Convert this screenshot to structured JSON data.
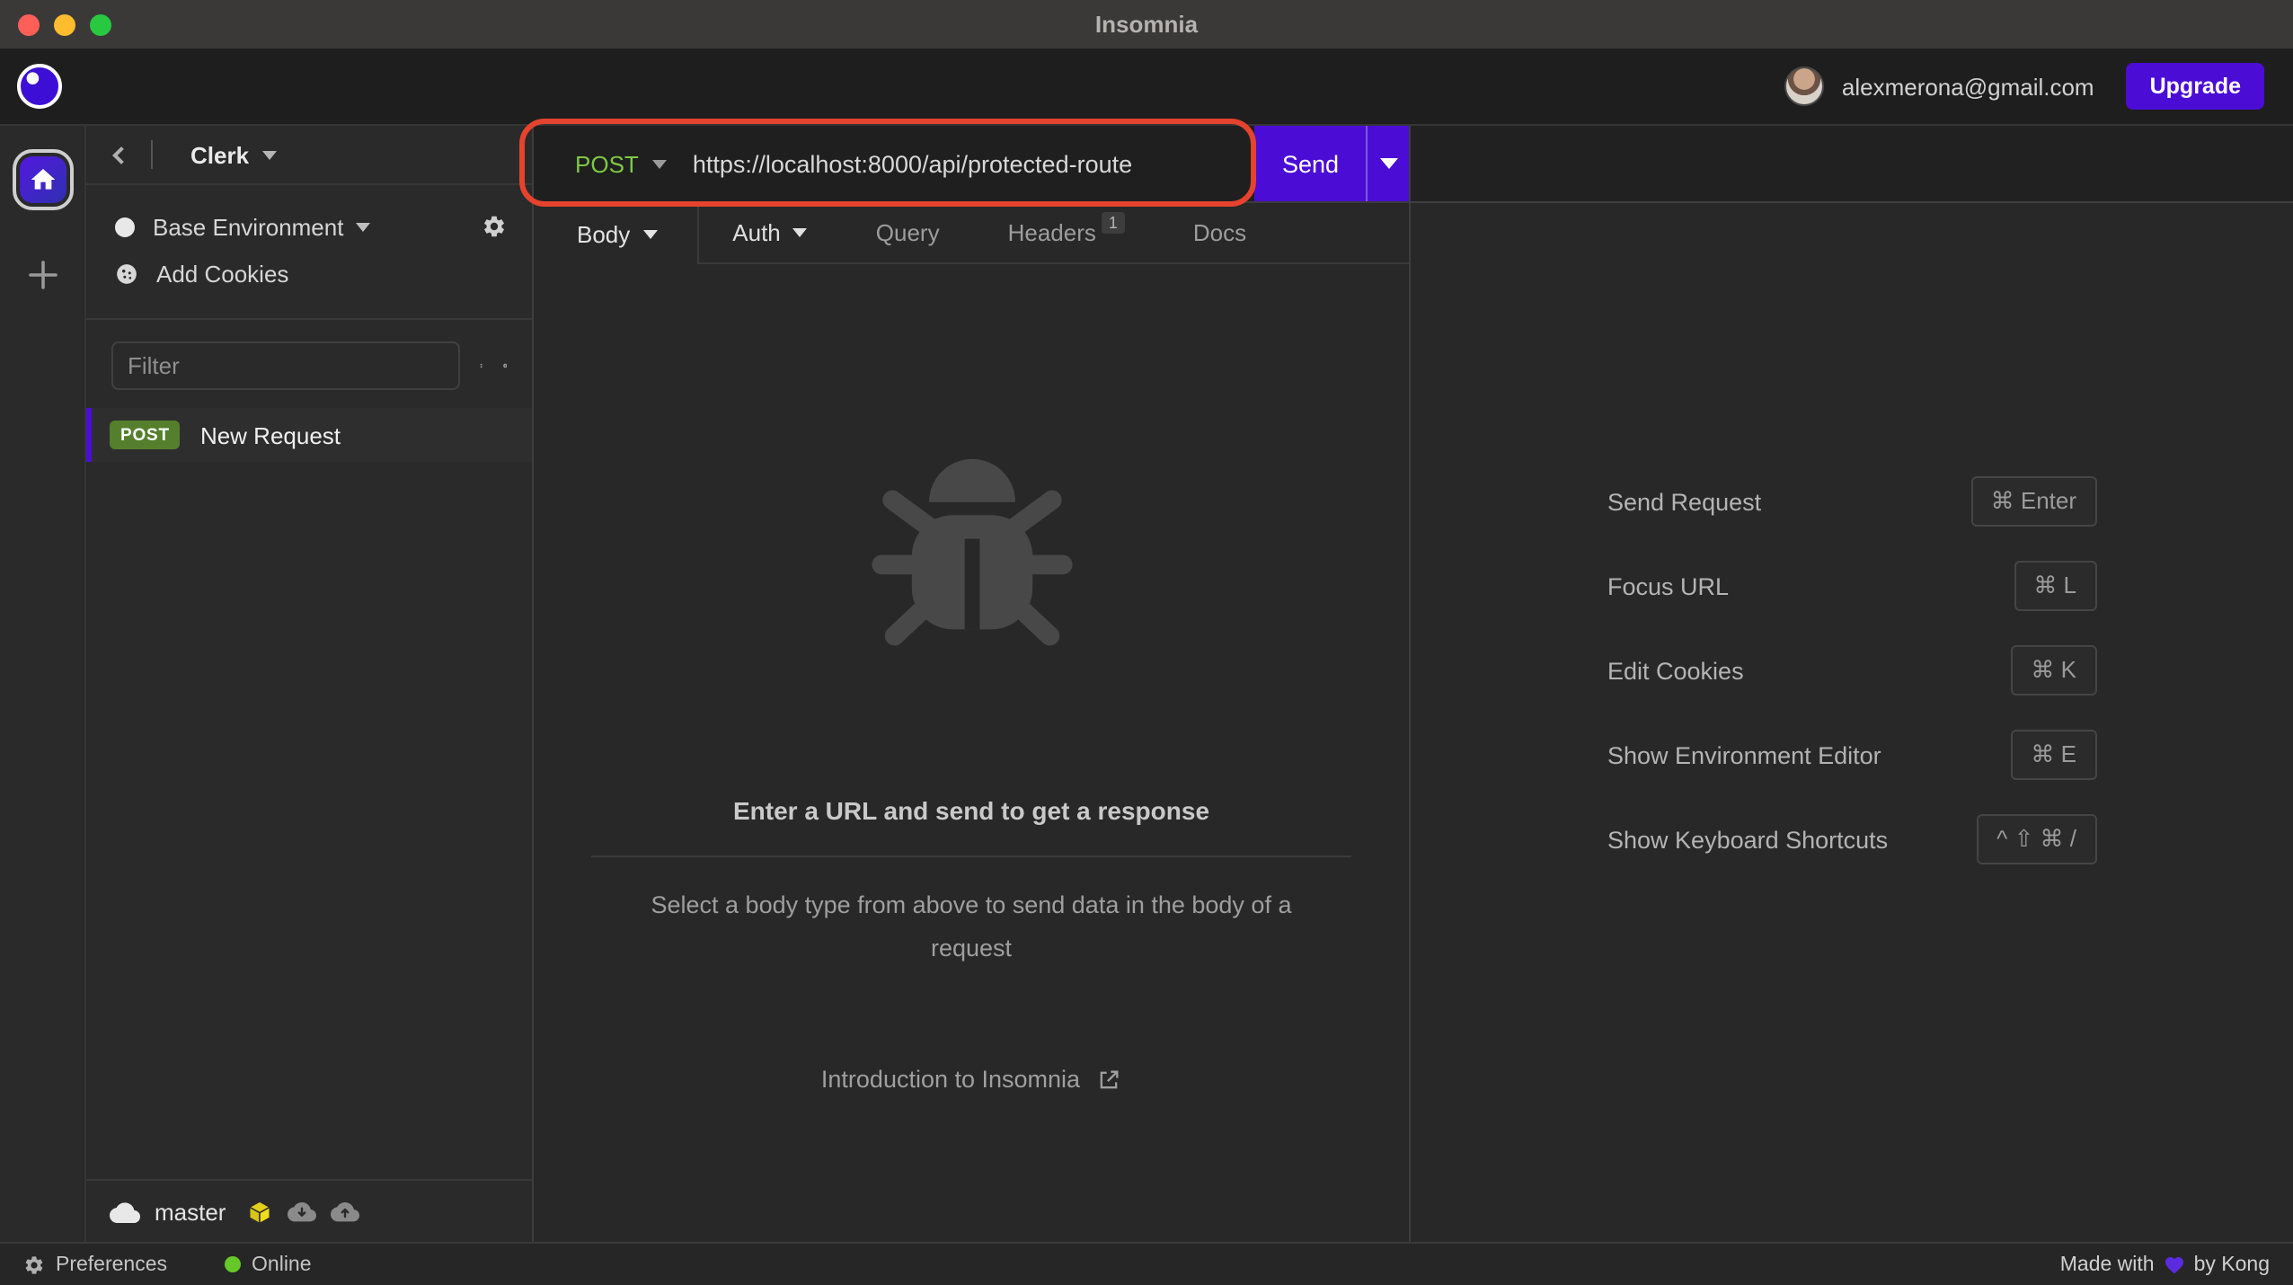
{
  "titlebar": {
    "title": "Insomnia"
  },
  "header": {
    "email": "alexmerona@gmail.com",
    "upgrade_label": "Upgrade"
  },
  "sidebar": {
    "project": "Clerk",
    "environment": "Base Environment",
    "add_cookies": "Add Cookies",
    "filter_placeholder": "Filter",
    "requests": [
      {
        "method": "POST",
        "name": "New Request"
      }
    ],
    "branch": "master"
  },
  "url_bar": {
    "method": "POST",
    "url": "https://localhost:8000/api/protected-route",
    "send_label": "Send"
  },
  "tabs": [
    {
      "label": "Body"
    },
    {
      "label": "Auth"
    },
    {
      "label": "Query"
    },
    {
      "label": "Headers",
      "badge": "1"
    },
    {
      "label": "Docs"
    }
  ],
  "empty_state": {
    "title": "Enter a URL and send to get a response",
    "subtitle": "Select a body type from above to send data in the body of a request",
    "link_label": "Introduction to Insomnia"
  },
  "shortcuts": {
    "items": [
      {
        "label": "Send Request",
        "keys": "⌘ Enter"
      },
      {
        "label": "Focus URL",
        "keys": "⌘ L"
      },
      {
        "label": "Edit Cookies",
        "keys": "⌘ K"
      },
      {
        "label": "Show Environment Editor",
        "keys": "⌘ E"
      },
      {
        "label": "Show Keyboard Shortcuts",
        "keys": "^ ⇧ ⌘ /"
      }
    ]
  },
  "statusbar": {
    "preferences_label": "Preferences",
    "online_label": "Online",
    "made_with_label": "Made with",
    "by_label": "by Kong"
  },
  "colors": {
    "accent_purple": "#4b0dd6",
    "method_green": "#7ec944",
    "badge_green": "#557f2d",
    "annotation_red": "#e5432e",
    "online_green": "#65c728",
    "sync_cube_yellow": "#e3cf1a"
  }
}
